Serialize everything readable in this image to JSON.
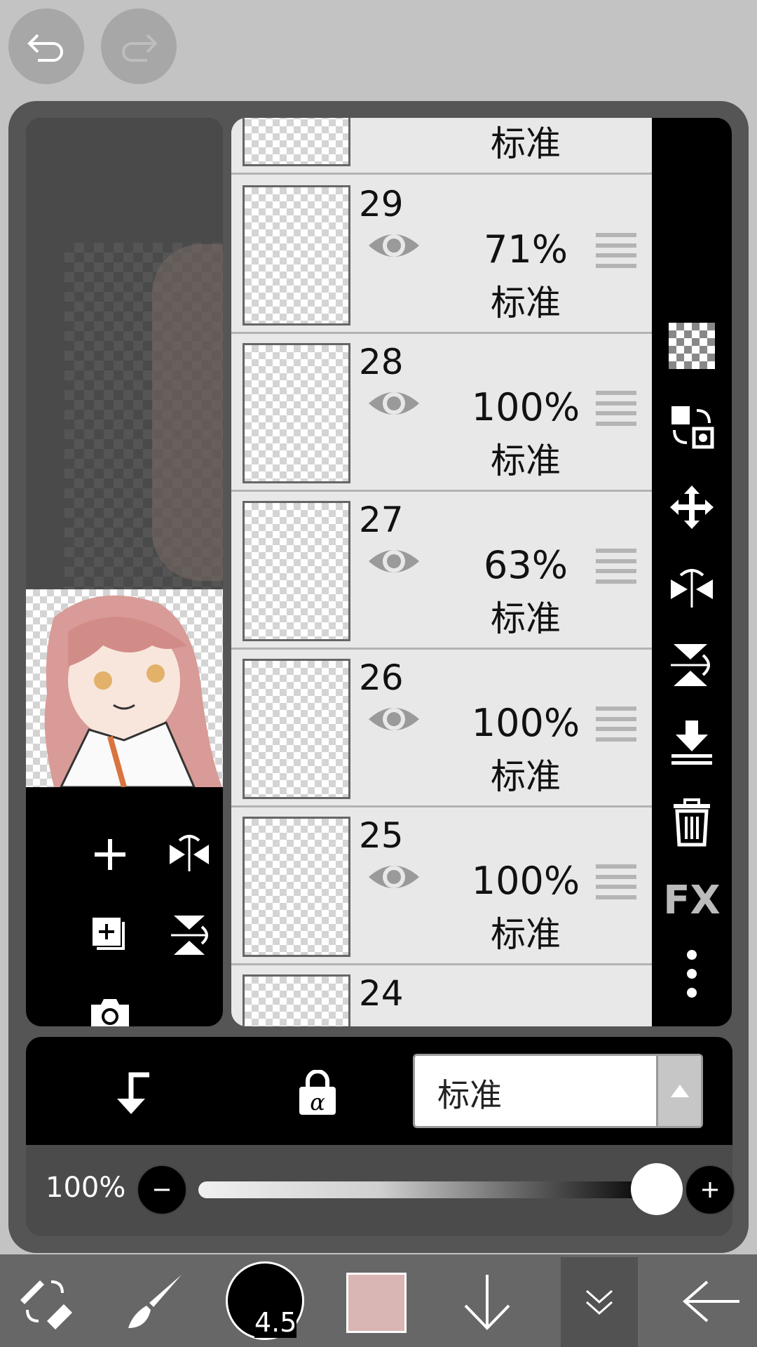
{
  "topbar": {
    "undo_icon": "undo-icon",
    "redo_icon": "redo-icon"
  },
  "preview": {
    "tools": [
      "add-layer-icon",
      "flip-horizontal-icon",
      "add-copy-icon",
      "flip-vertical-icon",
      "camera-icon"
    ]
  },
  "layers": [
    {
      "number": "",
      "opacity": "",
      "blend": "标准",
      "partial": "top"
    },
    {
      "number": "29",
      "opacity": "71%",
      "blend": "标准"
    },
    {
      "number": "28",
      "opacity": "100%",
      "blend": "标准"
    },
    {
      "number": "27",
      "opacity": "63%",
      "blend": "标准"
    },
    {
      "number": "26",
      "opacity": "100%",
      "blend": "标准"
    },
    {
      "number": "25",
      "opacity": "100%",
      "blend": "标准"
    },
    {
      "number": "24",
      "opacity": "",
      "blend": "",
      "partial": "bottom"
    }
  ],
  "right_tools": {
    "fx_label": "FX"
  },
  "layer_options": {
    "blend_mode": "标准"
  },
  "opacity_bar": {
    "value_label": "100%",
    "value": 1.0
  },
  "bottom_toolbar": {
    "brush_size": "4.5",
    "current_color": "#d9b5b3",
    "colors": {
      "accent_black": "#000000"
    }
  }
}
